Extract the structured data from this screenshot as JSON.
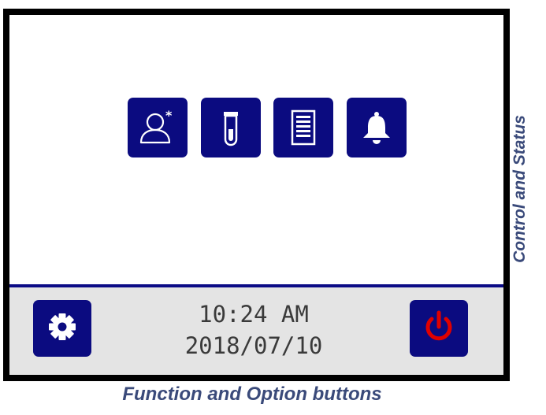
{
  "screen": {
    "function_buttons": [
      {
        "id": "user",
        "icon": "user-icon"
      },
      {
        "id": "sample",
        "icon": "test-tube-icon"
      },
      {
        "id": "report",
        "icon": "document-list-icon"
      },
      {
        "id": "alarm",
        "icon": "bell-icon"
      }
    ],
    "bottom_bar": {
      "settings_icon": "gear-icon",
      "power_icon": "power-icon",
      "time": "10:24 AM",
      "date": "2018/07/10"
    }
  },
  "captions": {
    "bottom": "Function and Option buttons",
    "side": "Control and Status"
  },
  "colors": {
    "button_bg": "#0b0b80",
    "icon_fg": "#ffffff",
    "power_fg": "#e00000",
    "divider": "#0b0b86",
    "bottom_bar_bg": "#e4e4e4",
    "frame": "#000000",
    "caption": "#3a4a7a"
  }
}
